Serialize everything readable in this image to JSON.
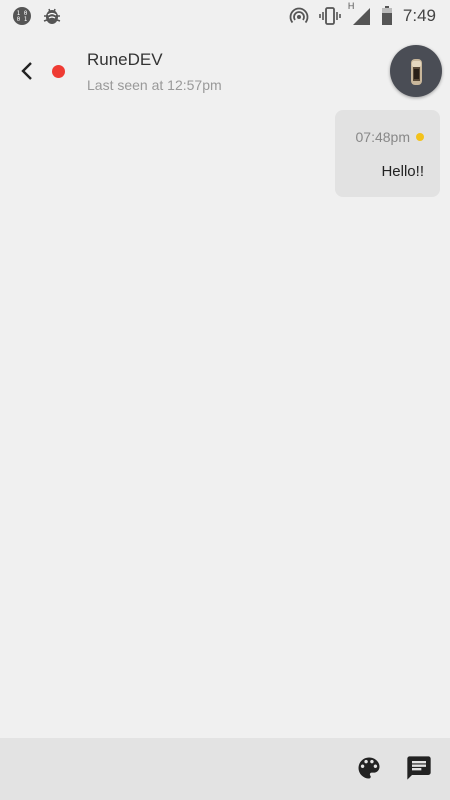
{
  "status_bar": {
    "time": "7:49",
    "network_type": "H",
    "icons": [
      "data-saver-icon",
      "bug-icon",
      "hotspot-icon",
      "vibrate-icon",
      "signal-icon",
      "battery-icon"
    ]
  },
  "header": {
    "back_icon": "chevron-left-icon",
    "contact_name": "RuneDEV",
    "last_seen": "Last seen at 12:57pm",
    "status_color": "#ef3b33"
  },
  "messages": [
    {
      "time": "07:48pm",
      "text": "Hello!!",
      "status_color": "#f3c21b"
    }
  ],
  "bottom_bar": {
    "icons": [
      "palette-icon",
      "chat-icon"
    ]
  }
}
